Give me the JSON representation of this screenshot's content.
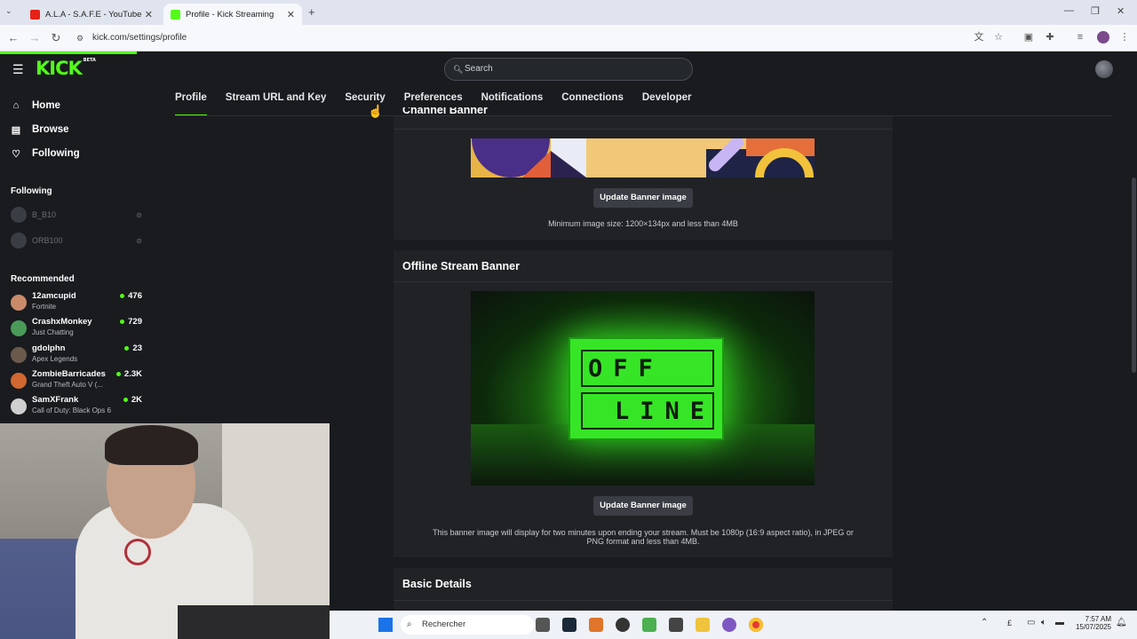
{
  "browser": {
    "tabs": [
      {
        "title": "A.L.A - S.A.F.E - YouTube",
        "active": false
      },
      {
        "title": "Profile - Kick Streaming",
        "active": true
      }
    ],
    "url": "kick.com/settings/profile"
  },
  "header": {
    "logo": "KICK",
    "logo_badge": "BETA",
    "search_placeholder": "Search"
  },
  "sidebar": {
    "nav": [
      {
        "label": "Home",
        "icon": "home-icon"
      },
      {
        "label": "Browse",
        "icon": "browse-icon"
      },
      {
        "label": "Following",
        "icon": "heart-icon"
      }
    ],
    "following_heading": "Following",
    "following": [
      {
        "name": "B_B10"
      },
      {
        "name": "ORB100"
      }
    ],
    "recommended_heading": "Recommended",
    "recommended": [
      {
        "name": "12amcupid",
        "game": "Fortnite",
        "viewers": "476",
        "color": "#c98a6a"
      },
      {
        "name": "CrashxMonkey",
        "game": "Just Chatting",
        "viewers": "729",
        "color": "#4a9a58"
      },
      {
        "name": "gdolphn",
        "game": "Apex Legends",
        "viewers": "23",
        "color": "#6a5a4c"
      },
      {
        "name": "ZombieBarricades",
        "game": "Grand Theft Auto V (...",
        "viewers": "2.3K",
        "color": "#d0682f"
      },
      {
        "name": "SamXFrank",
        "game": "Call of Duty: Black Ops 6",
        "viewers": "2K",
        "color": "#cfcfcf"
      }
    ]
  },
  "settings_tabs": [
    "Profile",
    "Stream URL and Key",
    "Security",
    "Preferences",
    "Notifications",
    "Connections",
    "Developer"
  ],
  "active_tab": "Profile",
  "channel_banner": {
    "heading": "Channel Banner",
    "button": "Update Banner image",
    "note": "Minimum image size: 1200×134px and less than 4MB"
  },
  "offline_banner": {
    "heading": "Offline Stream Banner",
    "sign_line1": "OFF",
    "sign_line2": "LINE",
    "button": "Update Banner image",
    "note_line1": "This banner image will display for two minutes upon ending your stream. Must be 1080p (16:9 aspect ratio), in JPEG or",
    "note_line2": "PNG format and less than 4MB."
  },
  "basic_details": {
    "heading": "Basic Details"
  },
  "taskbar": {
    "search": "Rechercher",
    "time": "7:57 AM",
    "date": "15/07/2025"
  },
  "colors": {
    "accent": "#53fc18",
    "background": "#191b1f"
  }
}
